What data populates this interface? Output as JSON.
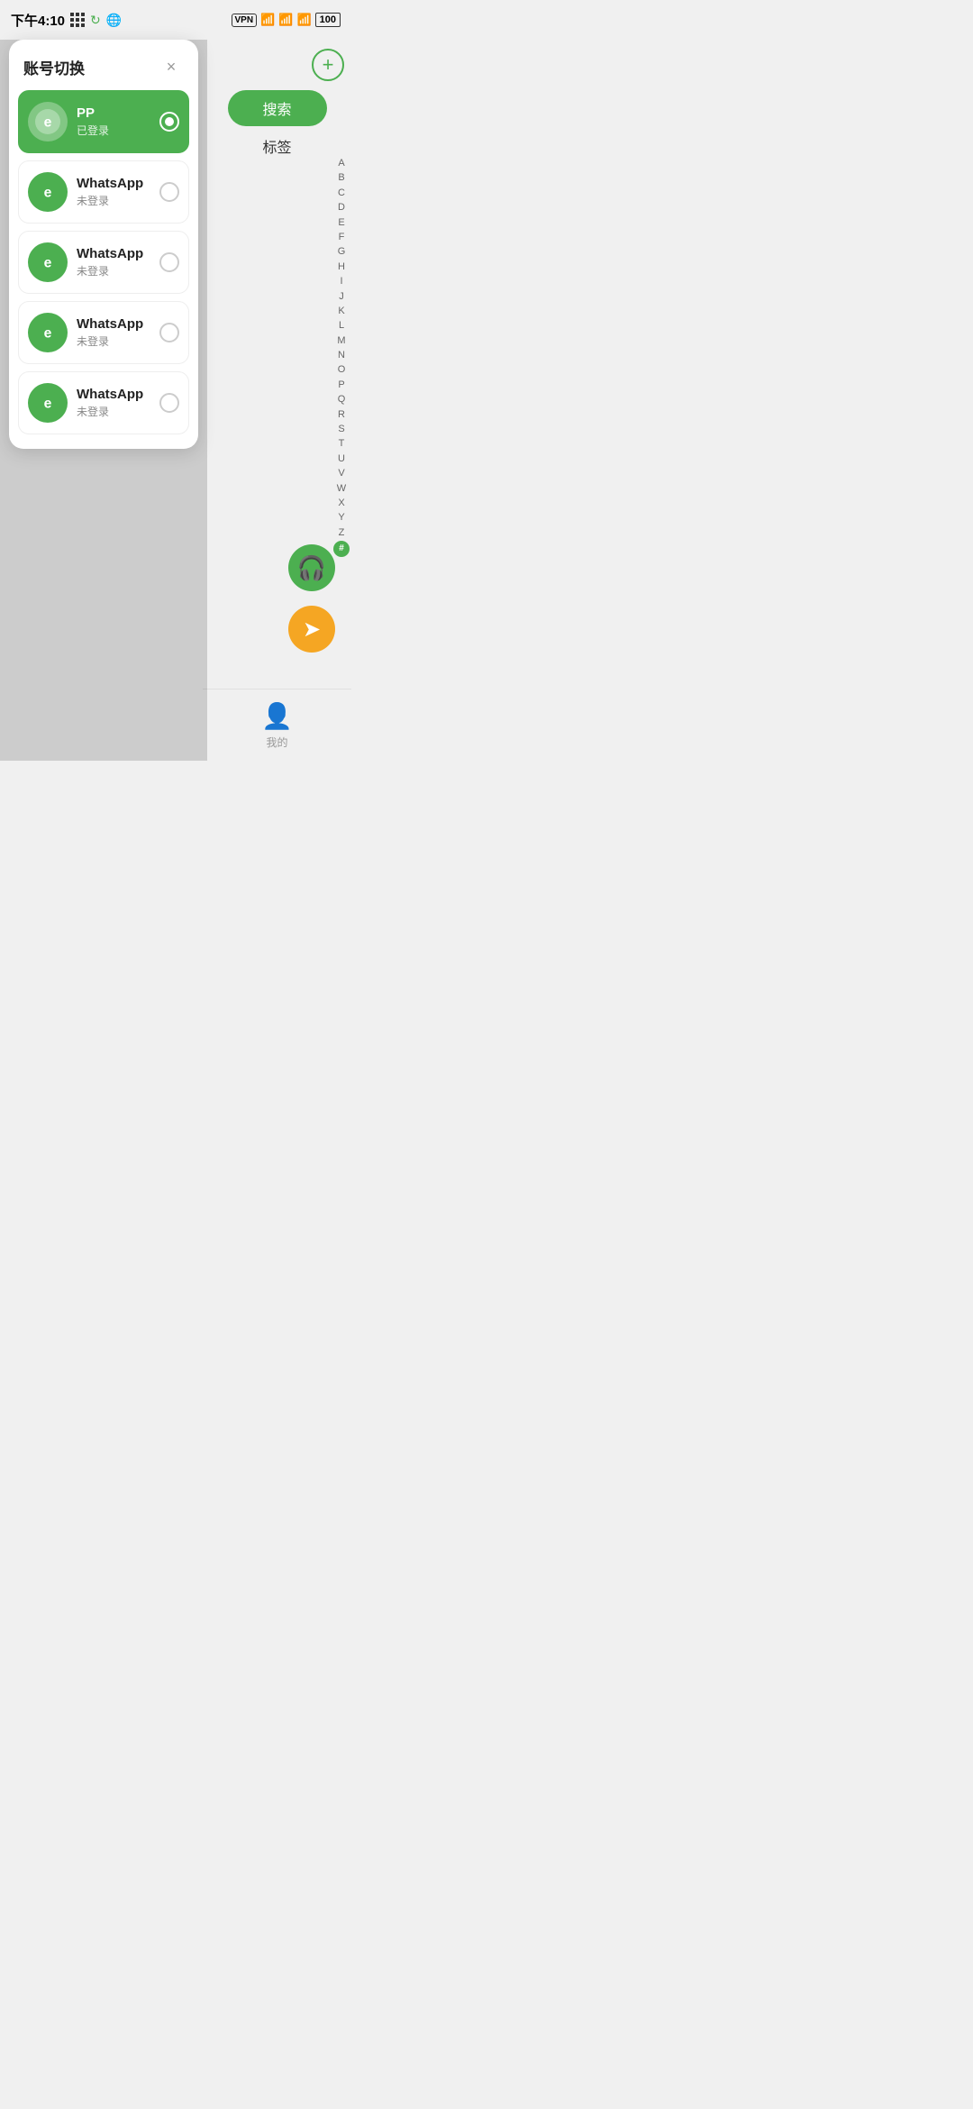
{
  "statusBar": {
    "time": "下午4:10",
    "leftIcons": [
      "grid",
      "refresh",
      "globe"
    ],
    "rightIcons": [
      "VPN",
      "signal1",
      "signal2",
      "wifi",
      "battery"
    ]
  },
  "dialog": {
    "title": "账号切换",
    "closeLabel": "×",
    "accounts": [
      {
        "id": "account-1",
        "name": "PP",
        "status": "已登录",
        "active": true
      },
      {
        "id": "account-2",
        "name": "WhatsApp",
        "status": "未登录",
        "active": false
      },
      {
        "id": "account-3",
        "name": "WhatsApp",
        "status": "未登录",
        "active": false
      },
      {
        "id": "account-4",
        "name": "WhatsApp",
        "status": "未登录",
        "active": false
      },
      {
        "id": "account-5",
        "name": "WhatsApp",
        "status": "未登录",
        "active": false
      }
    ]
  },
  "rightPanel": {
    "addLabel": "+",
    "searchLabel": "搜索",
    "tagLabel": "标签",
    "alphabetIndex": [
      "A",
      "B",
      "C",
      "D",
      "E",
      "F",
      "G",
      "H",
      "I",
      "J",
      "K",
      "L",
      "M",
      "N",
      "O",
      "P",
      "Q",
      "R",
      "S",
      "T",
      "U",
      "V",
      "W",
      "X",
      "Y",
      "Z",
      "#"
    ],
    "bottomNav": {
      "icon": "👤",
      "label": "我的"
    }
  },
  "colors": {
    "green": "#4caf50",
    "orange": "#f5a623",
    "white": "#ffffff",
    "gray": "#f0f0f0"
  }
}
